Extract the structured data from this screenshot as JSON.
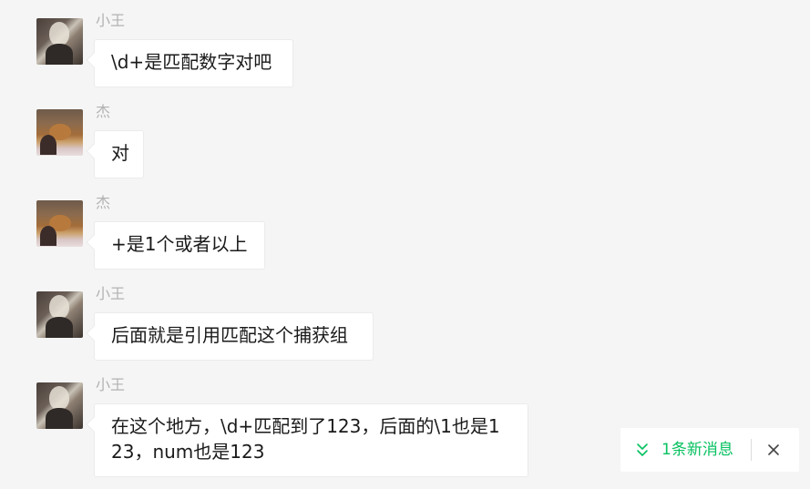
{
  "colors": {
    "background": "#f5f5f5",
    "bubble": "#ffffff",
    "sender_name": "#b2b2b2",
    "accent_green": "#07c160"
  },
  "messages": [
    {
      "sender": "小王",
      "avatar": "avatar-photo-wang",
      "text": "\\d+是匹配数字对吧"
    },
    {
      "sender": "杰",
      "avatar": "avatar-photo-jie",
      "text": "对"
    },
    {
      "sender": "杰",
      "avatar": "avatar-photo-jie",
      "text": "+是1个或者以上"
    },
    {
      "sender": "小王",
      "avatar": "avatar-photo-wang",
      "text": "后面就是引用匹配这个捕获组"
    },
    {
      "sender": "小王",
      "avatar": "avatar-photo-wang",
      "text_line1": "在这个地方，\\d+匹配到了123，后面的\\1也是1",
      "text_line2": "23，num也是123"
    }
  ],
  "new_message_toast": {
    "label": "1条新消息",
    "icon": "double-chevron-down-icon",
    "close_icon": "close-icon"
  }
}
